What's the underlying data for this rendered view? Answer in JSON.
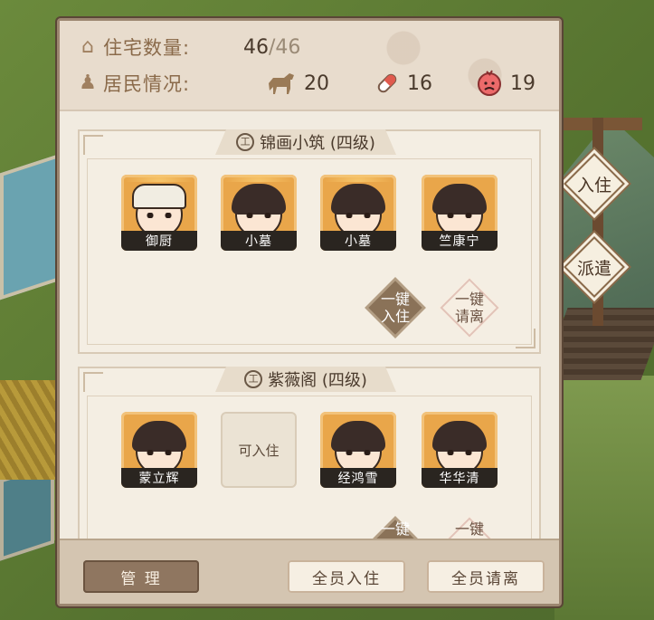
{
  "summary": {
    "housing_label": "住宅数量:",
    "housing_current": "46",
    "housing_separator": "/",
    "housing_max": "46",
    "residents_label": "居民情况:",
    "horse_count": "20",
    "pill_count": "16",
    "angry_count": "19"
  },
  "side_actions": {
    "move_in": "入住",
    "dispatch": "派遣"
  },
  "houses": [
    {
      "title": "锦画小筑 (四级)",
      "badge": "工",
      "residents": [
        "御厨",
        "小墓",
        "小墓",
        "竺康宁"
      ],
      "one_click_in": "一键\n入住",
      "one_click_out": "一键\n请离"
    },
    {
      "title": "紫薇阁 (四级)",
      "badge": "工",
      "residents": [
        "蒙立辉",
        "经鸿雪",
        "华华清"
      ],
      "empty_slot": "可入住",
      "one_click_in": "一键",
      "one_click_out": "一键"
    }
  ],
  "footer": {
    "manage": "管 理",
    "all_move_in": "全员入住",
    "all_leave": "全员请离"
  },
  "colors": {
    "panel_bg": "#f1ebe0",
    "portrait_gold": "#e9a64a",
    "accent_brown": "#8a6a4a",
    "angry_red": "#e06060"
  }
}
